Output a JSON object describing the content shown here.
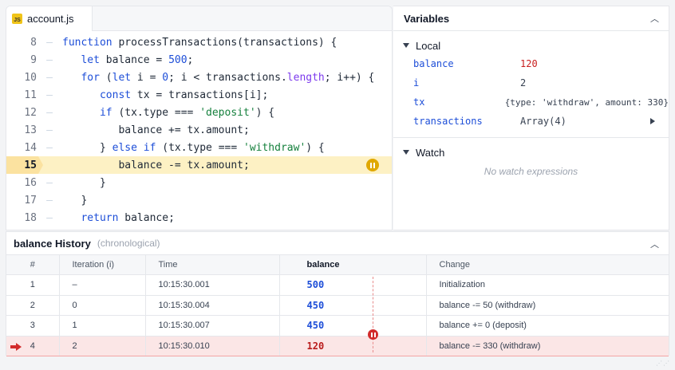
{
  "editor": {
    "tab_label": "account.js",
    "tab_icon": "JS",
    "lines": [
      {
        "num": "8"
      },
      {
        "num": "9"
      },
      {
        "num": "10"
      },
      {
        "num": "11"
      },
      {
        "num": "12"
      },
      {
        "num": "13"
      },
      {
        "num": "14"
      },
      {
        "num": "15"
      },
      {
        "num": "16"
      },
      {
        "num": "17"
      },
      {
        "num": "18"
      }
    ],
    "active_line": "15"
  },
  "variables": {
    "title": "Variables",
    "local_label": "Local",
    "local": [
      {
        "name": "balance",
        "value": "120"
      },
      {
        "name": "i",
        "value": "2"
      },
      {
        "name": "tx",
        "value": "{type: 'withdraw', amount: 330}"
      },
      {
        "name": "transactions",
        "value": "Array(4)"
      }
    ],
    "watch_label": "Watch",
    "watch_empty": "No watch expressions"
  },
  "history": {
    "title": "balance History",
    "subtitle": "(chronological)",
    "columns": [
      "#",
      "Iteration (i)",
      "Time",
      "balance",
      "Change"
    ],
    "rows": [
      {
        "n": "1",
        "iter": "–",
        "time": "10:15:30.001",
        "balance": "500",
        "change": "Initialization"
      },
      {
        "n": "2",
        "iter": "0",
        "time": "10:15:30.004",
        "balance": "450",
        "change": "balance -= 50 (withdraw)"
      },
      {
        "n": "3",
        "iter": "1",
        "time": "10:15:30.007",
        "balance": "450",
        "change": "balance += 0 (deposit)"
      },
      {
        "n": "4",
        "iter": "2",
        "time": "10:15:30.010",
        "balance": "120",
        "change": "balance -= 330 (withdraw)"
      }
    ],
    "current_row": "4"
  },
  "colors": {
    "active_line_bg": "#fdf1c4",
    "current_row_bg": "#fbe6e6",
    "accent_red": "#d22b2b",
    "keyword_blue": "#1d4ed8",
    "string_green": "#15803d"
  }
}
